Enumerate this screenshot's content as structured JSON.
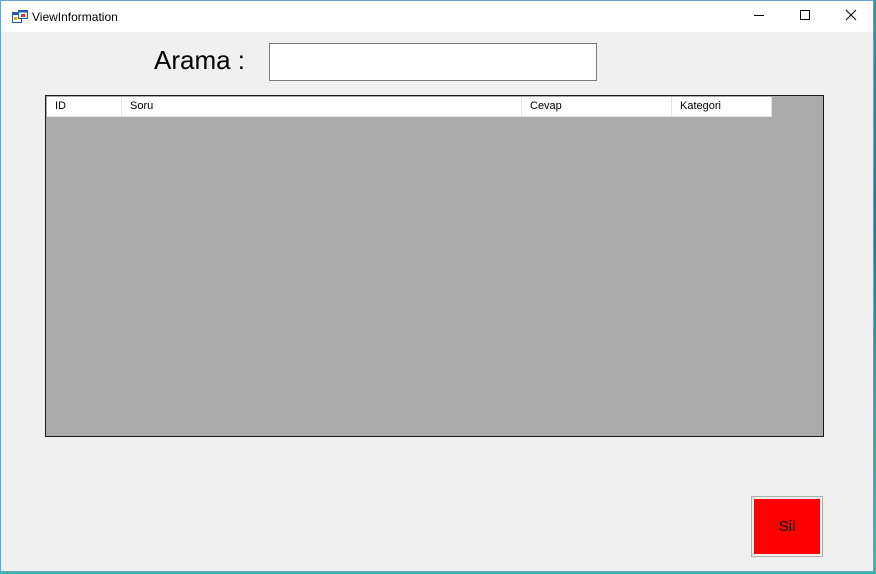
{
  "window": {
    "title": "ViewInformation",
    "icon": "form-app-icon",
    "controls": [
      "minimize-icon",
      "maximize-icon",
      "close-icon"
    ]
  },
  "search": {
    "label": "Arama :",
    "value": "",
    "placeholder": ""
  },
  "grid": {
    "columns": [
      "ID",
      "Soru",
      "Cevap",
      "Kategori"
    ],
    "rows": [],
    "background_color": "#ababab"
  },
  "actions": {
    "delete_label": "Sil",
    "delete_color": "#ff0000"
  }
}
